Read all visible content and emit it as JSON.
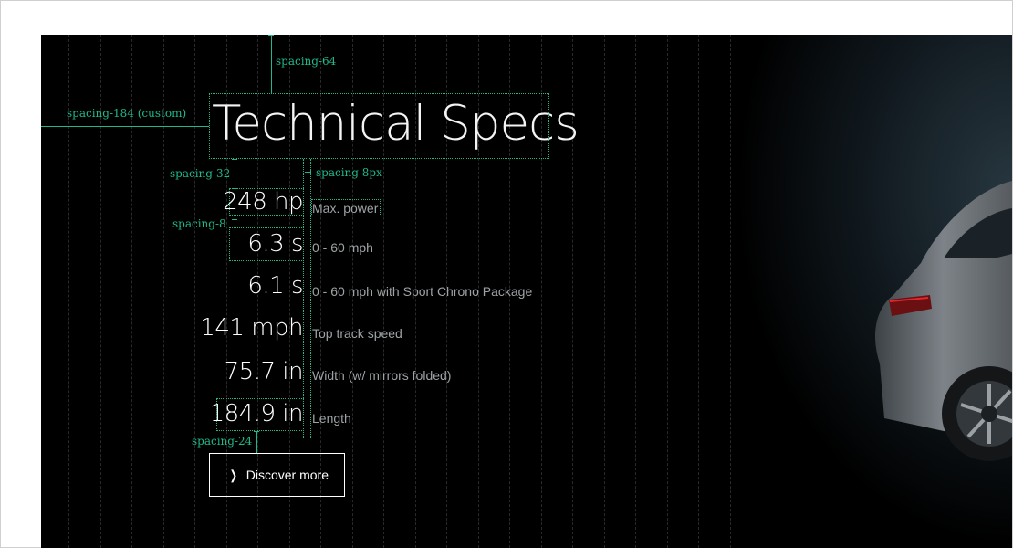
{
  "section": {
    "title": "Technical Specs",
    "specs": [
      {
        "value": "248 hp",
        "label": "Max. power"
      },
      {
        "value": "6.3 s",
        "label": "0 - 60 mph"
      },
      {
        "value": "6.1 s",
        "label": "0 - 60 mph with Sport Chrono Package"
      },
      {
        "value": "141 mph",
        "label": "Top track speed"
      },
      {
        "value": "75.7 in",
        "label": "Width (w/ mirrors folded)"
      },
      {
        "value": "184.9 in",
        "label": "Length"
      }
    ],
    "cta": {
      "label": "Discover more",
      "icon": "chevron-right-icon"
    }
  },
  "annotations": {
    "top": "spacing-64",
    "left": "spacing-184 (custom)",
    "title_gap": "spacing-32",
    "label_gap": "spacing 8px",
    "row_gap": "spacing-8",
    "button_gap": "spacing-24",
    "color": "#1fb88a"
  },
  "colors": {
    "background": "#000000",
    "text": "#ffffff",
    "label": "#9ea3a6",
    "guide": "#1fb88a"
  }
}
